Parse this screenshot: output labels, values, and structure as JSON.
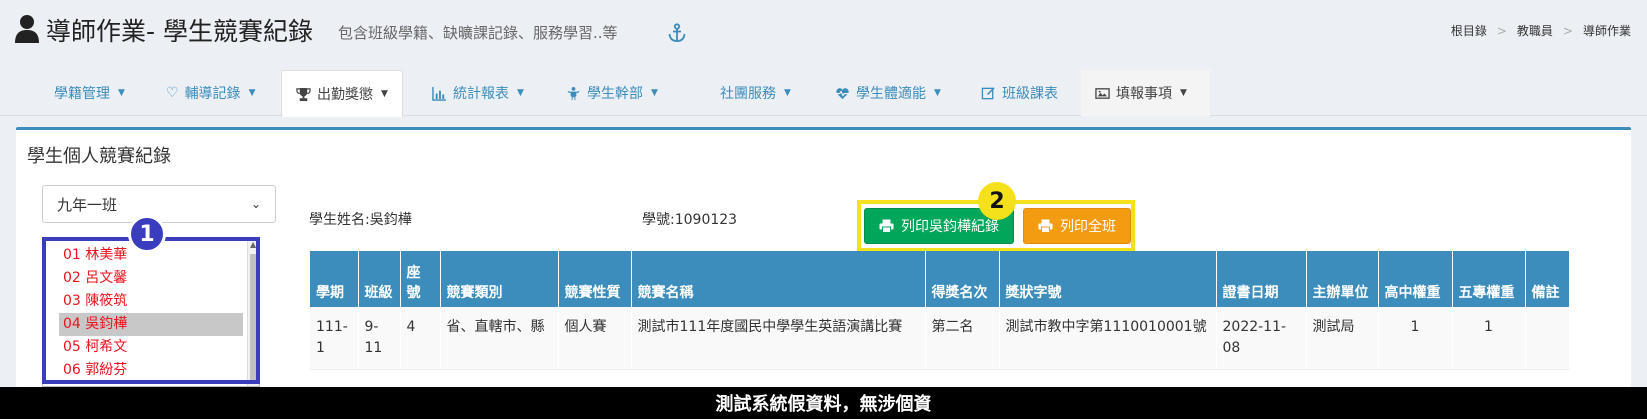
{
  "header": {
    "title": "導師作業- 學生競賽紀錄",
    "subtitle": "包含班級學籍、缺曠課記錄、服務學習..等",
    "breadcrumb": [
      "根目錄",
      "教職員",
      "導師作業"
    ]
  },
  "tabs": [
    {
      "label": "學籍管理",
      "icon": "id-card-icon"
    },
    {
      "label": "輔導記錄",
      "icon": "heart-outline-icon"
    },
    {
      "label": "出勤獎懲",
      "icon": "trophy-icon"
    },
    {
      "label": "統計報表",
      "icon": "bar-chart-icon"
    },
    {
      "label": "學生幹部",
      "icon": "child-icon"
    },
    {
      "label": "社團服務",
      "icon": ""
    },
    {
      "label": "學生體適能",
      "icon": "heartbeat-icon"
    },
    {
      "label": "班級課表",
      "icon": "edit-icon"
    },
    {
      "label": "填報事項",
      "icon": "picture-icon"
    }
  ],
  "panel": {
    "title": "學生個人競賽紀錄",
    "class_select": "九年一班",
    "students": [
      "01 林美華",
      "02 呂文馨",
      "03 陳筱筑",
      "04 吳鈞樺",
      "05 柯希文",
      "06 郭紛芬"
    ],
    "selected_student_index": 3,
    "student_name": "學生姓名:吳鈞樺",
    "student_id": "學號:1090123",
    "print_student_label": "列印吳鈞樺紀錄",
    "print_class_label": "列印全班"
  },
  "annotations": {
    "badge1": "1",
    "badge2": "2"
  },
  "table": {
    "headers": [
      "學期",
      "班級",
      "座號",
      "競賽類別",
      "競賽性質",
      "競賽名稱",
      "得獎名次",
      "獎狀字號",
      "證書日期",
      "主辦單位",
      "高中權重",
      "五專權重",
      "備註"
    ],
    "rows": [
      [
        "111-1",
        "9-11",
        "4",
        "省、直轄市、縣",
        "個人賽",
        "測試市111年度國民中學學生英語演講比賽",
        "第二名",
        "測試市教中字第1110010001號",
        "2022-11-08",
        "測試局",
        "1",
        "1",
        ""
      ]
    ]
  },
  "footer": {
    "notice": "測試系統假資料，無涉個資"
  },
  "colors": {
    "primary": "#3c8dbc",
    "success": "#00a65a",
    "warning": "#f39c12",
    "highlight_blue": "#3b3dbf",
    "highlight_yellow": "#f5e11b",
    "student_text": "#e8141d"
  }
}
